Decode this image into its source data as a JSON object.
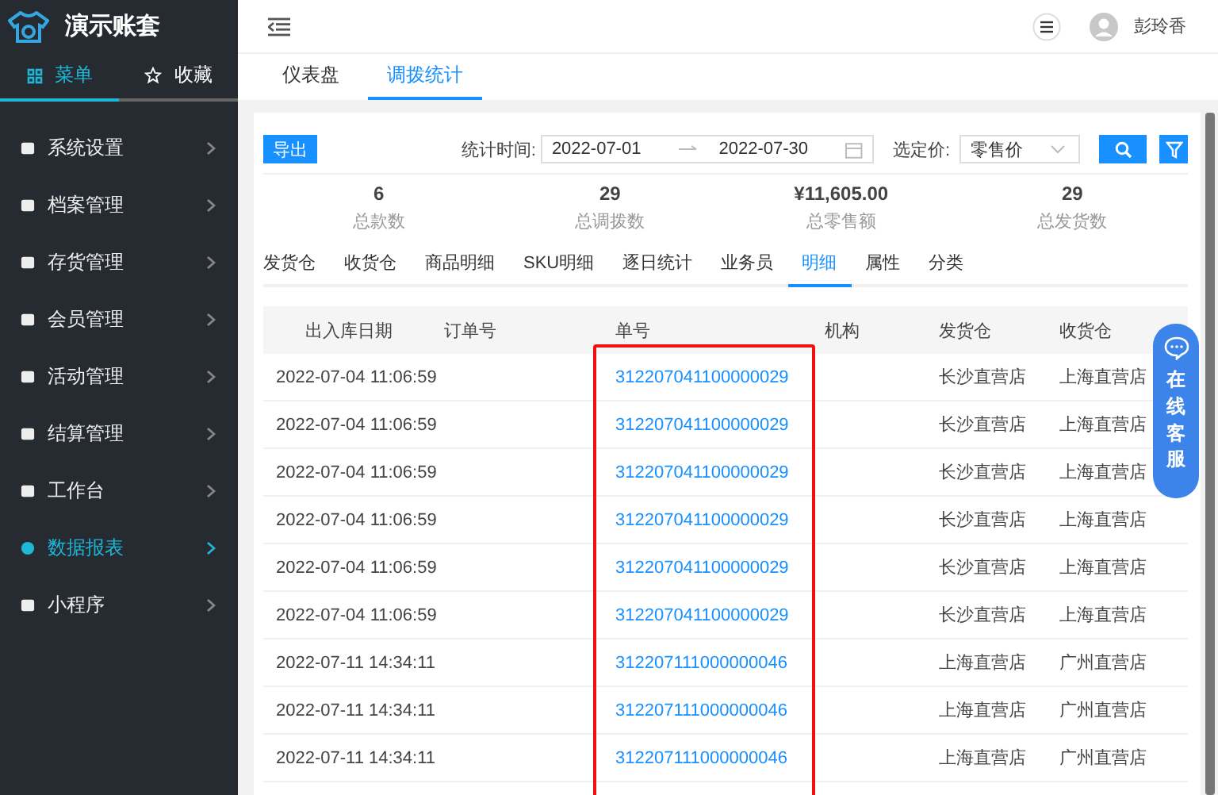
{
  "brand": {
    "title": "演示账套"
  },
  "sidebar_tabs": [
    {
      "label": "菜单",
      "selected": true
    },
    {
      "label": "收藏",
      "selected": false
    }
  ],
  "sidebar": {
    "items": [
      {
        "label": "系统设置",
        "selected": false
      },
      {
        "label": "档案管理",
        "selected": false
      },
      {
        "label": "存货管理",
        "selected": false
      },
      {
        "label": "会员管理",
        "selected": false
      },
      {
        "label": "活动管理",
        "selected": false
      },
      {
        "label": "结算管理",
        "selected": false
      },
      {
        "label": "工作台",
        "selected": false
      },
      {
        "label": "数据报表",
        "selected": true
      },
      {
        "label": "小程序",
        "selected": false
      }
    ]
  },
  "user": {
    "name": "彭玲香"
  },
  "page_tabs": [
    {
      "label": "仪表盘",
      "selected": false
    },
    {
      "label": "调拨统计",
      "selected": true
    }
  ],
  "toolbar": {
    "export": "导出",
    "date_label": "统计时间:",
    "date_from": "2022-07-01",
    "date_to": "2022-07-30",
    "price_label": "选定价:",
    "price_value": "零售价"
  },
  "stats": [
    {
      "value": "6",
      "label": "总款数"
    },
    {
      "value": "29",
      "label": "总调拨数"
    },
    {
      "value": "¥11,605.00",
      "label": "总零售额"
    },
    {
      "value": "29",
      "label": "总发货数"
    }
  ],
  "sub_tabs": [
    {
      "label": "发货仓",
      "selected": false
    },
    {
      "label": "收货仓",
      "selected": false
    },
    {
      "label": "商品明细",
      "selected": false
    },
    {
      "label": "SKU明细",
      "selected": false
    },
    {
      "label": "逐日统计",
      "selected": false
    },
    {
      "label": "业务员",
      "selected": false
    },
    {
      "label": "明细",
      "selected": true
    },
    {
      "label": "属性",
      "selected": false
    },
    {
      "label": "分类",
      "selected": false
    }
  ],
  "table": {
    "columns": [
      {
        "label": "出入库日期",
        "highlighted": false
      },
      {
        "label": "订单号",
        "highlighted": false
      },
      {
        "label": "单号",
        "highlighted": true
      },
      {
        "label": "机构",
        "highlighted": false
      },
      {
        "label": "发货仓",
        "highlighted": false
      },
      {
        "label": "收货仓",
        "highlighted": false
      }
    ],
    "rows": [
      [
        "2022-07-04 11:06:59",
        "",
        "312207041100000029",
        "",
        "长沙直营店",
        "上海直营店"
      ],
      [
        "2022-07-04 11:06:59",
        "",
        "312207041100000029",
        "",
        "长沙直营店",
        "上海直营店"
      ],
      [
        "2022-07-04 11:06:59",
        "",
        "312207041100000029",
        "",
        "长沙直营店",
        "上海直营店"
      ],
      [
        "2022-07-04 11:06:59",
        "",
        "312207041100000029",
        "",
        "长沙直营店",
        "上海直营店"
      ],
      [
        "2022-07-04 11:06:59",
        "",
        "312207041100000029",
        "",
        "长沙直营店",
        "上海直营店"
      ],
      [
        "2022-07-04 11:06:59",
        "",
        "312207041100000029",
        "",
        "长沙直营店",
        "上海直营店"
      ],
      [
        "2022-07-11 14:34:11",
        "",
        "312207111000000046",
        "",
        "上海直营店",
        "广州直营店"
      ],
      [
        "2022-07-11 14:34:11",
        "",
        "312207111000000046",
        "",
        "上海直营店",
        "广州直营店"
      ],
      [
        "2022-07-11 14:34:11",
        "",
        "312207111000000046",
        "",
        "上海直营店",
        "广州直营店"
      ]
    ]
  },
  "chat_widget": {
    "label": "在线客服"
  }
}
